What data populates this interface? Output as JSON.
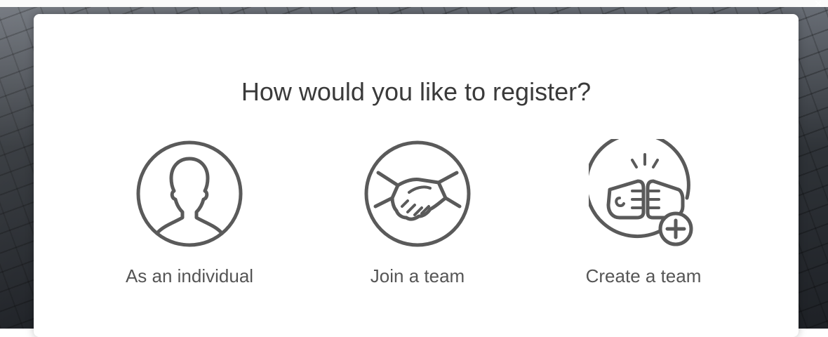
{
  "modal": {
    "title": "How would you like to register?",
    "options": [
      {
        "label": "As an individual",
        "icon": "person-silhouette-icon"
      },
      {
        "label": "Join a team",
        "icon": "handshake-icon"
      },
      {
        "label": "Create a team",
        "icon": "fist-bump-plus-icon"
      }
    ]
  },
  "colors": {
    "icon_stroke": "#5a5a5a",
    "title_text": "#3a3a3a",
    "label_text": "#555555",
    "modal_background": "#ffffff"
  }
}
